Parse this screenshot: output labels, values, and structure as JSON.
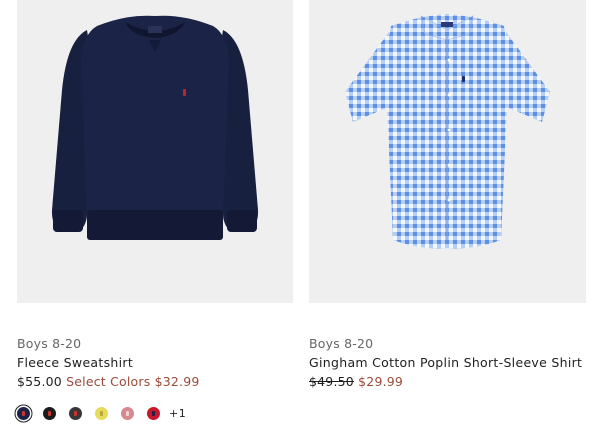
{
  "products": [
    {
      "category": "Boys 8-20",
      "title": "Fleece Sweatshirt",
      "price": "$55.00",
      "sale_label": "Select Colors $32.99",
      "swatches": [
        {
          "name": "navy",
          "color": "#1d2247",
          "selected": true
        },
        {
          "name": "black",
          "color": "#1b1b1b"
        },
        {
          "name": "charcoal",
          "color": "#3a3536"
        },
        {
          "name": "yellow",
          "color": "#e6dc5a"
        },
        {
          "name": "pink",
          "color": "#d68a8e"
        },
        {
          "name": "red",
          "color": "#c8162c"
        }
      ],
      "more_colors": "+1"
    },
    {
      "category": "Boys 8-20",
      "title": "Gingham Cotton Poplin Short-Sleeve Shirt",
      "original_price": "$49.50",
      "sale_price": "$29.99"
    }
  ]
}
